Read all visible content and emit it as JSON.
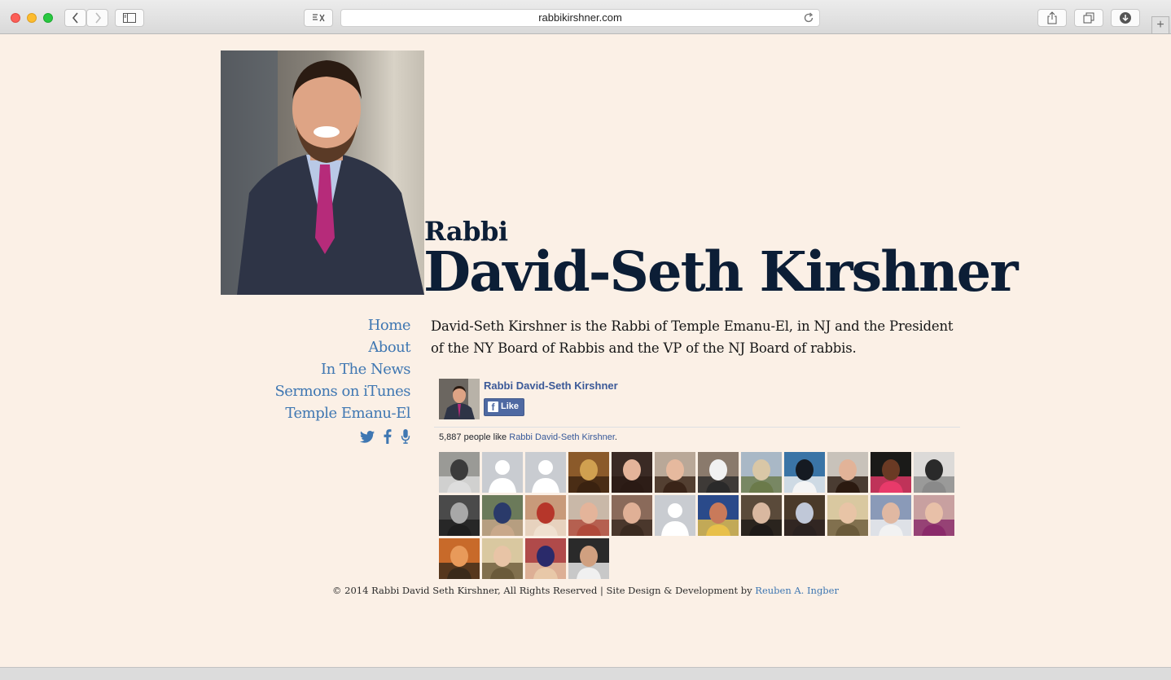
{
  "browser": {
    "url": "rabbikirshner.com",
    "icons": {
      "back": "chevron-left-icon",
      "forward": "chevron-right-icon",
      "sidebar": "sidebar-icon",
      "reader": "reader-icon",
      "reload": "reload-icon",
      "share": "share-icon",
      "tabs": "tabs-icon",
      "downloads": "download-icon",
      "new_tab": "plus-icon"
    }
  },
  "header": {
    "title_small": "Rabbi",
    "title_large": "David-Seth Kirshner"
  },
  "nav": {
    "items": [
      "Home",
      "About",
      "In The News",
      "Sermons on iTunes",
      "Temple Emanu-El"
    ],
    "social": [
      "twitter-icon",
      "facebook-icon",
      "microphone-icon"
    ]
  },
  "bio": "David-Seth Kirshner is the Rabbi of Temple Emanu-El, in NJ and the President of the NY Board of Rabbis and the VP of the NJ Board of rabbis.",
  "facebook": {
    "page_name": "Rabbi David-Seth Kirshner",
    "like_label": "Like",
    "count_text": "5,887 people like",
    "count_link": "Rabbi David-Seth Kirshner",
    "count_suffix": ".",
    "faces": [
      "car",
      "silhouette",
      "silhouette",
      "lion",
      "woman-smiling",
      "woman-glasses",
      "man-indoor",
      "group-outdoor",
      "penguins",
      "young-man",
      "woman",
      "couple",
      "man-bw",
      "people-crowd",
      "man-cap",
      "family",
      "couple-selfie",
      "silhouette",
      "woman-blue",
      "man-hat",
      "man-with-baby",
      "woman-blonde",
      "older-couple",
      "three-people",
      "dancers",
      "woman-blonde",
      "child",
      "man-bandana"
    ]
  },
  "footer": {
    "text": "© 2014 Rabbi David Seth Kirshner, All Rights Reserved | Site Design & Development by",
    "link": "Reuben A. Ingber"
  },
  "colors": {
    "page_bg": "#fbf0e6",
    "title": "#0c1e36",
    "link": "#3f77b2",
    "fb_blue": "#4e69a2"
  }
}
